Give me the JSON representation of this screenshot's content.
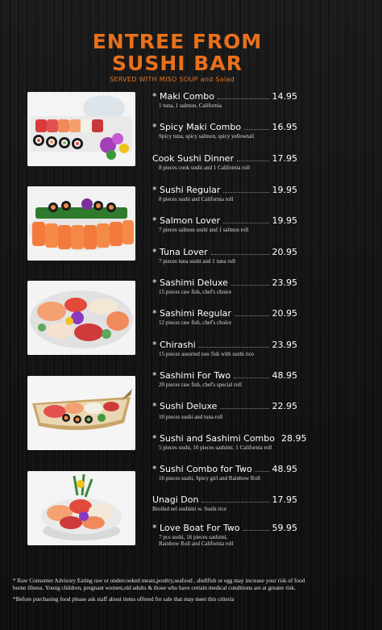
{
  "header": {
    "title_line1": "ENTREE FROM",
    "title_line2": "SUSHI BAR",
    "subtitle": "SERVED WITH MISO SOUP and Salad"
  },
  "items": [
    {
      "name": "* Maki Combo",
      "price": "14.95",
      "desc": [
        "1 tuna,  1 salmon, California"
      ]
    },
    {
      "name": "* Spicy Maki Combo",
      "price": "16.95",
      "desc": [
        "Spicy tuna, spicy salmon, spicy yellowtail"
      ]
    },
    {
      "name": "Cook Sushi Dinner",
      "price": "17.95",
      "desc": [
        "8 pieces cook sushi and 1 California roll"
      ]
    },
    {
      "name": "* Sushi Regular",
      "price": "19.95",
      "desc": [
        "8 pieces sushi and California roll"
      ]
    },
    {
      "name": "* Salmon Lover",
      "price": "19.95",
      "desc": [
        "7 pieces salmon sushi and 1 salmon roll"
      ]
    },
    {
      "name": "* Tuna Lover",
      "price": "20.95",
      "desc": [
        "7 pieces tuna sushi and 1 tuna roll"
      ]
    },
    {
      "name": "* Sashimi Deluxe",
      "price": "23.95",
      "desc": [
        "15 pieces raw fish, chef's choice"
      ]
    },
    {
      "name": "* Sashimi Regular",
      "price": "20.95",
      "desc": [
        "12 pieces raw fish, chef's choice"
      ]
    },
    {
      "name": "* Chirashi",
      "price": "23.95",
      "desc": [
        "15 pieces assorted raw fish with sushi rice"
      ]
    },
    {
      "name": "* Sashimi For Two",
      "price": "48.95",
      "desc": [
        "20 pieces raw fish, chef's special roll"
      ]
    },
    {
      "name": "* Sushi Deluxe",
      "price": "22.95",
      "desc": [
        "10 pieces sushi and tuna roll"
      ]
    },
    {
      "name": "* Sushi and Sashimi Combo",
      "price": "28.95",
      "desc": [
        "5 pieces sushi, 10 pieces sashimi. 1 California roll"
      ]
    },
    {
      "name": "* Sushi Combo for Two",
      "price": "48.95",
      "desc": [
        "16 pieces sushi, Spicy girl and Rainbow Roll"
      ]
    },
    {
      "name": "Unagi Don",
      "price": "17.95",
      "desc": [
        "Broiled eel sushimi w. Sushi rice"
      ]
    },
    {
      "name": "* Love Boat For Two",
      "price": "59.95",
      "desc": [
        "7 pcs sushi, 16 pieces sashimi,",
        "Rainbow Roll and California roll"
      ]
    }
  ],
  "photos": [
    {
      "name": "Maki and sushi platter photo"
    },
    {
      "name": "Salmon sushi platter photo"
    },
    {
      "name": "Sashimi platter photo"
    },
    {
      "name": "Sushi boat photo"
    },
    {
      "name": "Sashimi bowl photo"
    }
  ],
  "footer": {
    "advisory": "* Raw    Consumer Advisory Eating raw or undercooked meats,poultry,seafood ,   shellfish or egg may increase your risk of food borne illness. Young children, pregnant women,old adults & those who have certain medical conditions are at greater risk.",
    "note": "*Before purchasing food please ask staff about items offered for sale that may meet this criteria"
  },
  "colors": {
    "accent": "#e8701c",
    "background": "#151515",
    "text": "#ffffff"
  }
}
